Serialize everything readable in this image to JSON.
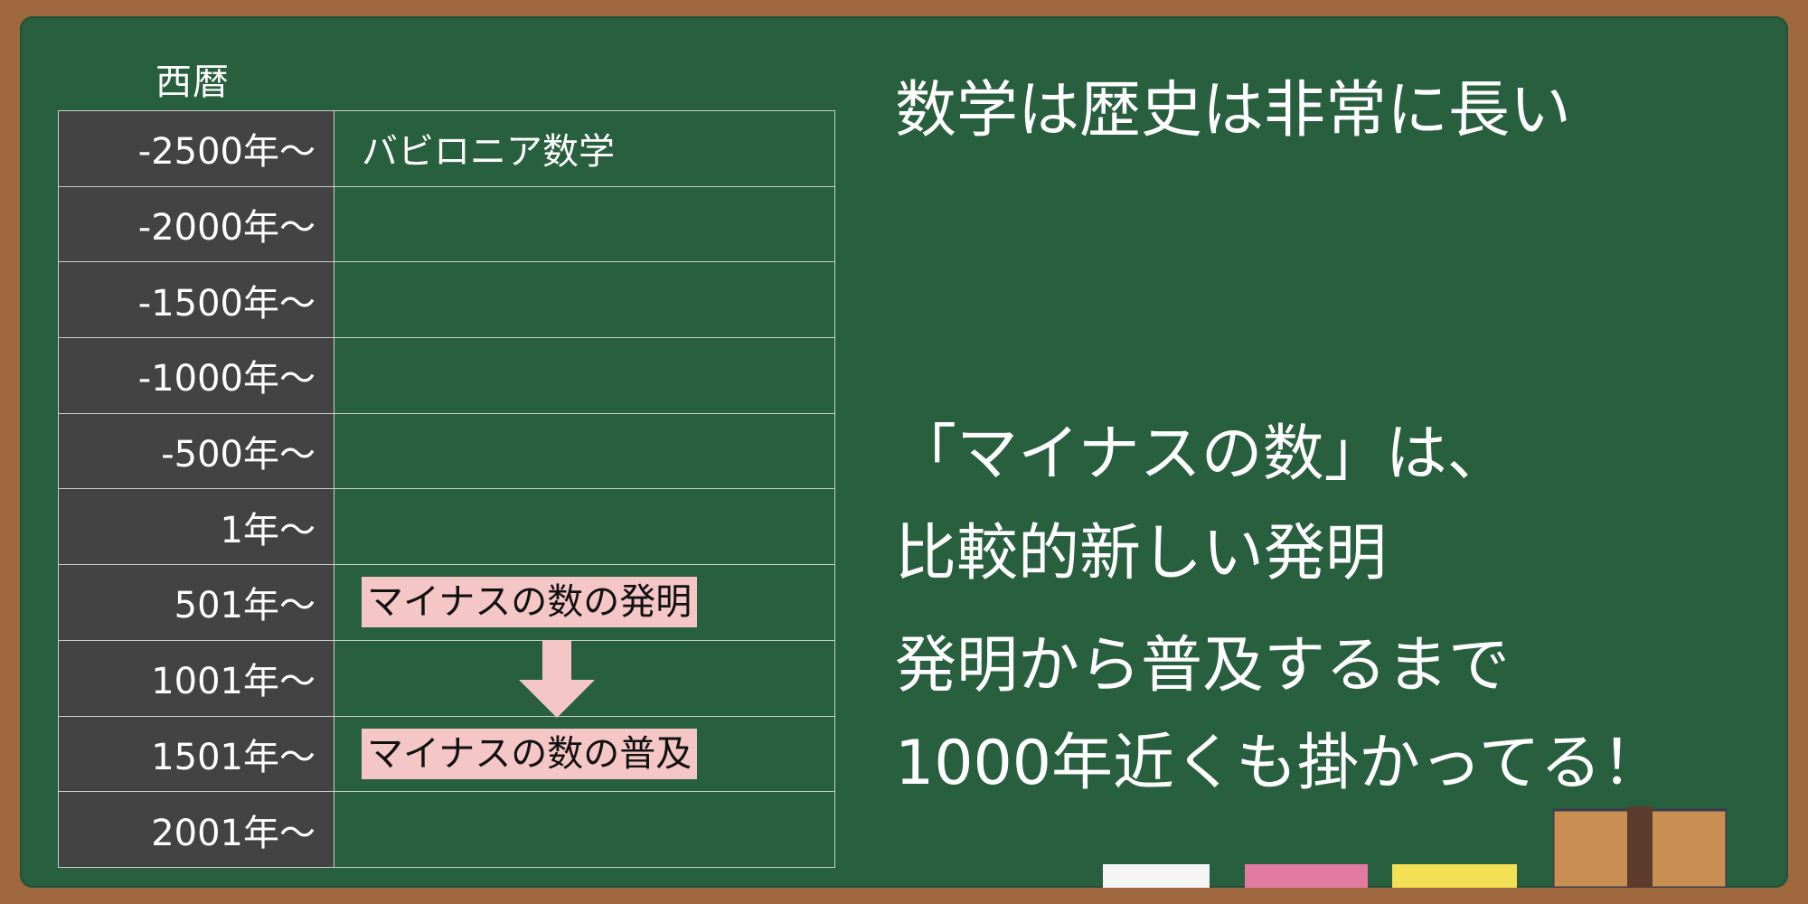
{
  "header": {
    "label": "西暦"
  },
  "timeline": {
    "rows": [
      {
        "year": "-2500年～",
        "event": "バビロニア数学"
      },
      {
        "year": "-2000年～",
        "event": ""
      },
      {
        "year": "-1500年～",
        "event": ""
      },
      {
        "year": "-1000年～",
        "event": ""
      },
      {
        "year": "-500年～",
        "event": ""
      },
      {
        "year": "1年～",
        "event": ""
      },
      {
        "year": "501年～",
        "event": "マイナスの数の発明"
      },
      {
        "year": "1001年～",
        "event": ""
      },
      {
        "year": "1501年～",
        "event": "マイナスの数の普及"
      },
      {
        "year": "2001年～",
        "event": ""
      }
    ]
  },
  "right": {
    "title": "数学は歴史は非常に長い",
    "line1": "「マイナスの数」は、",
    "line2": "比較的新しい発明",
    "line3": "発明から普及するまで",
    "line4": "1000年近くも掛かってる！"
  },
  "colors": {
    "board": "#285f3f",
    "frame": "#a0683f",
    "year_cell": "#434343",
    "highlight": "#f4c7c6",
    "arrow": "#f4c7c6",
    "chalk_white": "#f5f5f5",
    "chalk_pink": "#e37aa0",
    "chalk_yellow": "#f3df53"
  }
}
